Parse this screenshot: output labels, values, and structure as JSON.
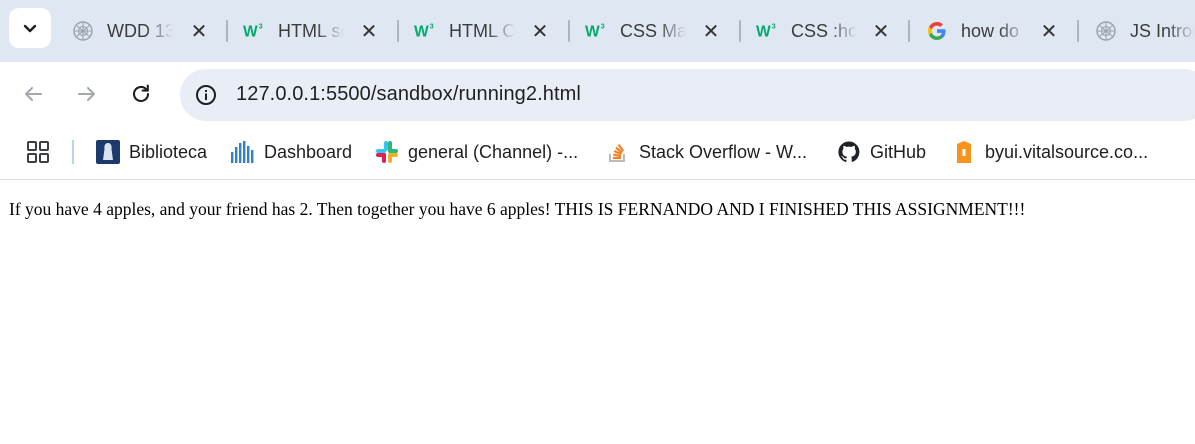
{
  "tabs": [
    {
      "title": "WDD 13",
      "favicon": "web-icon"
    },
    {
      "title": "HTML se",
      "favicon": "w3schools-icon"
    },
    {
      "title": "HTML O",
      "favicon": "w3schools-icon"
    },
    {
      "title": "CSS Mar",
      "favicon": "w3schools-icon"
    },
    {
      "title": "CSS :hov",
      "favicon": "w3schools-icon"
    },
    {
      "title": "how do",
      "favicon": "google-icon"
    },
    {
      "title": "JS Introd",
      "favicon": "web-icon"
    }
  ],
  "toolbar": {
    "url": "127.0.0.1:5500/sandbox/running2.html"
  },
  "bookmarks": [
    {
      "label": "Biblioteca",
      "icon": "biblioteca-icon"
    },
    {
      "label": "Dashboard",
      "icon": "dashboard-icon"
    },
    {
      "label": "general (Channel) -...",
      "icon": "slack-icon"
    },
    {
      "label": "Stack Overflow - W...",
      "icon": "stackoverflow-icon"
    },
    {
      "label": "GitHub",
      "icon": "github-icon"
    },
    {
      "label": "byui.vitalsource.co...",
      "icon": "vitalsource-icon"
    }
  ],
  "page": {
    "text": "If you have 4 apples, and your friend has 2. Then together you have 6 apples! THIS IS FERNANDO AND I FINISHED THIS ASSIGNMENT!!!"
  },
  "colors": {
    "tabstrip": "#dfe7f3",
    "omnibox": "#e9eef6",
    "w3_green": "#04aa6d"
  }
}
